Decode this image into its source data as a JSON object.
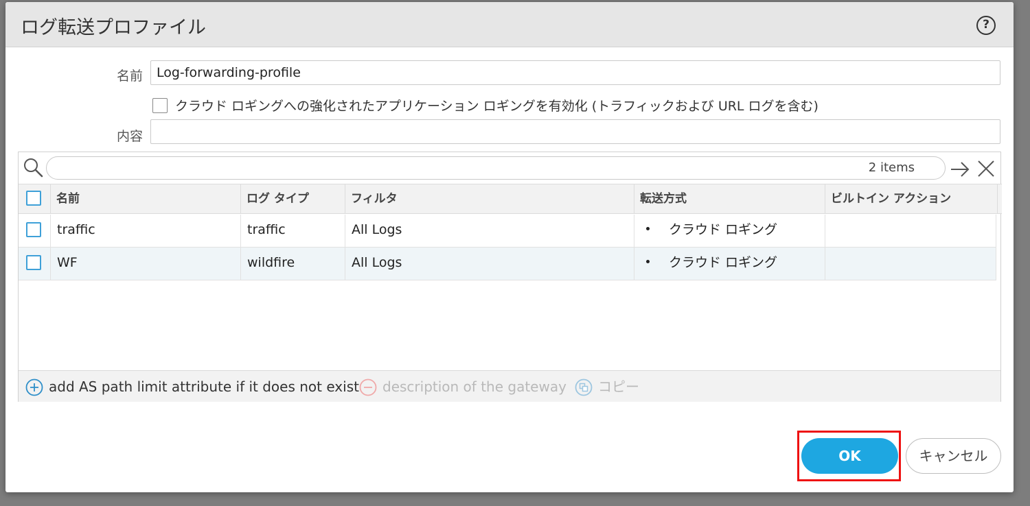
{
  "dialog": {
    "title": "ログ転送プロファイル",
    "help_icon": "question-circle-icon",
    "help_glyph": "?"
  },
  "form": {
    "name_label": "名前",
    "name_value": "Log-forwarding-profile",
    "enhanced_logging_label": "クラウド ロギングへの強化されたアプリケーション ロギングを有効化 (トラフィックおよび URL ログを含む)",
    "enhanced_logging_checked": false,
    "description_label": "内容",
    "description_value": ""
  },
  "grid": {
    "search_placeholder": "",
    "items_count": "2 items",
    "columns": [
      "名前",
      "ログ タイプ",
      "フィルタ",
      "転送方式",
      "ビルトイン アクション"
    ],
    "rows": [
      {
        "name": "traffic",
        "log_type": "traffic",
        "filter": "All Logs",
        "forward_method": "クラウド ロギング",
        "builtin_action": ""
      },
      {
        "name": "WF",
        "log_type": "wildfire",
        "filter": "All Logs",
        "forward_method": "クラウド ロギング",
        "builtin_action": ""
      }
    ],
    "toolbar": {
      "add_label": "add AS path limit attribute if it does not exist",
      "delete_label": "description of the gateway",
      "copy_label": "コピー"
    }
  },
  "footer": {
    "ok_label": "OK",
    "cancel_label": "キャンセル"
  },
  "colors": {
    "accent": "#1ea7e1",
    "highlight": "#ee1111",
    "checkbox_blue": "#3ea0d8"
  }
}
